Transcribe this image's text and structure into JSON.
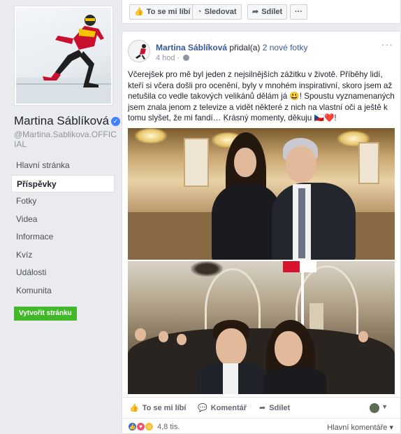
{
  "page": {
    "name": "Martina Sáblíková",
    "handle": "@Martina.Sablikova.OFFICIAL",
    "verified_glyph": "✓",
    "create_page_button": "Vytvořit stránku"
  },
  "nav": [
    {
      "label": "Hlavní stránka",
      "active": false
    },
    {
      "label": "Příspěvky",
      "active": true
    },
    {
      "label": "Fotky",
      "active": false
    },
    {
      "label": "Videa",
      "active": false
    },
    {
      "label": "Informace",
      "active": false
    },
    {
      "label": "Kvíz",
      "active": false
    },
    {
      "label": "Události",
      "active": false
    },
    {
      "label": "Komunita",
      "active": false
    }
  ],
  "action_bar": {
    "like": "To se mi líbí",
    "follow": "Sledovat",
    "share": "Sdílet",
    "more": "···"
  },
  "post": {
    "author": "Martina Sáblíková",
    "verb": " přidal(a) ",
    "photos_link": "2 nové fotky",
    "time": "4 hod",
    "menu": "···",
    "text": "Včerejšek pro mě byl jeden z nejsilnějších zážitku v životě. Příběhy lidí, kteří si včera došli pro ocenění, byly v mnohém inspirativní, skoro jsem až netušila co vedle takových velikánů dělám já 😃! Spoustu vyznamenaných jsem znala jenom z televize a vidět některé z nich na vlastní oči a ještě k tomu slyšet, že mi fandí… Krásný momenty, děkuju 🇨🇿❤️!",
    "actions": {
      "like": "To se mi líbí",
      "comment": "Komentář",
      "share": "Sdílet"
    },
    "reactions": {
      "count": "4,8 tis.",
      "types": [
        "like",
        "love",
        "wow"
      ]
    },
    "comments_filter": "Hlavní komentáře ▾"
  },
  "icons": {
    "like": "thumbs-up-icon",
    "follow": "rss-icon",
    "share": "share-arrow-icon",
    "comment": "speech-bubble-icon",
    "globe": "globe-icon"
  }
}
